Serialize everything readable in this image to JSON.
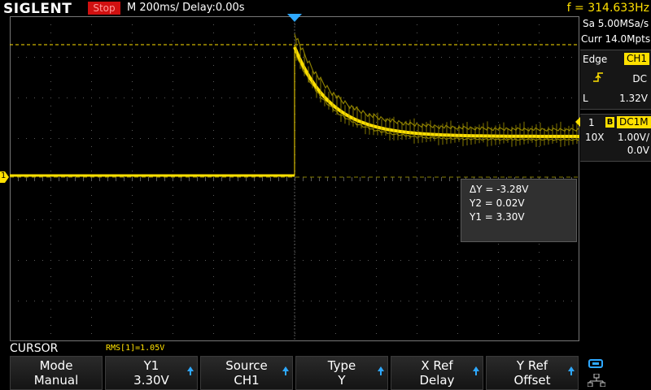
{
  "brand": "SIGLENT",
  "status": "Stop",
  "timebase": "M 200ms/  Delay:0.00s",
  "frequency": "f = 314.633Hz",
  "acquisition": {
    "sample_rate": "Sa 5.00MSa/s",
    "memory": "Curr 14.0Mpts"
  },
  "trigger": {
    "type": "Edge",
    "source": "CH1",
    "coupling": "DC",
    "level_label": "L",
    "level": "1.32V"
  },
  "channel": {
    "number": "1",
    "bw_flag": "B",
    "coupling_impedance": "DC1M",
    "probe": "10X",
    "scale": "1.00V/",
    "offset": "0.0V"
  },
  "ground_marker": "1",
  "cursor_readout": {
    "delta_y": "ΔY = -3.28V",
    "y2": "Y2 = 0.02V",
    "y1": "Y1 = 3.30V"
  },
  "menu_title": "CURSOR",
  "measurement": "RMS[1]=1.05V",
  "softkeys": [
    {
      "label": "Mode",
      "value": "Manual",
      "arrow": false
    },
    {
      "label": "Y1",
      "value": "3.30V",
      "arrow": true
    },
    {
      "label": "Source",
      "value": "CH1",
      "arrow": true
    },
    {
      "label": "Type",
      "value": "Y",
      "arrow": true
    },
    {
      "label": "X Ref",
      "value": "Delay",
      "arrow": true
    },
    {
      "label": "Y Ref",
      "value": "Offset",
      "arrow": true
    }
  ],
  "colors": {
    "ch1": "#ffe000",
    "accent": "#2ea8ff",
    "stop": "#d01010"
  },
  "icons": [
    "usb-icon",
    "network-icon"
  ]
}
